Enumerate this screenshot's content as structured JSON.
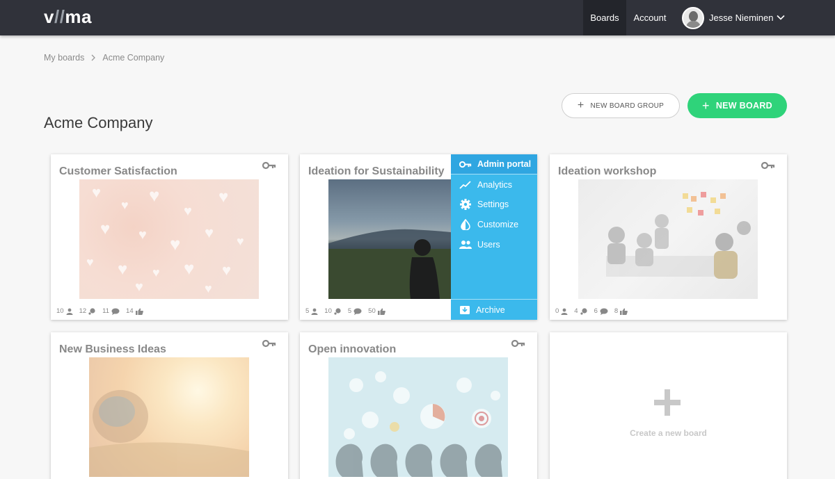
{
  "app": {
    "logo_text": "viima",
    "nav": {
      "boards": "Boards",
      "account": "Account"
    },
    "user": {
      "name": "Jesse Nieminen"
    }
  },
  "breadcrumb": {
    "items": [
      "My boards",
      "Acme Company"
    ]
  },
  "page": {
    "title": "Acme Company",
    "new_board_group_label": "NEW BOARD GROUP",
    "new_board_label": "NEW BOARD"
  },
  "boards": [
    {
      "title": "Customer Satisfaction",
      "stats": {
        "users": "10",
        "ideas": "12",
        "comments": "11",
        "likes": "14"
      }
    },
    {
      "title": "Ideation for Sustainability",
      "stats": {
        "users": "5",
        "ideas": "10",
        "comments": "5",
        "likes": "50"
      }
    },
    {
      "title": "Ideation workshop",
      "stats": {
        "users": "0",
        "ideas": "4",
        "comments": "6",
        "likes": "8"
      }
    },
    {
      "title": "New Business Ideas"
    },
    {
      "title": "Open innovation"
    }
  ],
  "admin_menu": {
    "header": "Admin portal",
    "items": [
      "Analytics",
      "Settings",
      "Customize",
      "Users"
    ],
    "archive": "Archive"
  },
  "create_board": {
    "label": "Create a new board"
  },
  "colors": {
    "topbar": "#30323a",
    "accent_green": "#2fd37a",
    "menu_blue": "#3bb9ec"
  },
  "icons": [
    "key-icon",
    "user-icon",
    "ideas-icon",
    "comment-icon",
    "thumbs-up-icon",
    "analytics-icon",
    "gear-icon",
    "customize-icon",
    "users-icon",
    "archive-icon",
    "plus-icon",
    "chevron-down-icon",
    "chevron-right-icon"
  ]
}
